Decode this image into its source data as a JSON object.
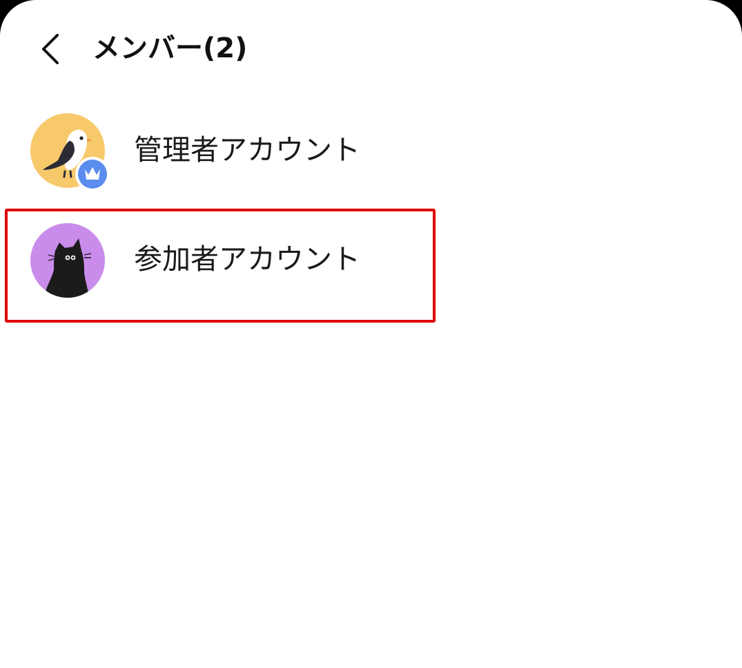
{
  "header": {
    "back_icon": "chevron-left-icon",
    "title": "メンバー(2)"
  },
  "members": [
    {
      "name": "管理者アカウント",
      "avatar": "bird-avatar",
      "avatar_bg": "#F7C96B",
      "role_badge": "crown-icon",
      "badge_color": "#5B8DEF"
    },
    {
      "name": "参加者アカウント",
      "avatar": "cat-avatar",
      "avatar_bg": "#C98CEB"
    }
  ],
  "highlight": {
    "target": "参加者アカウント",
    "color": "#E00000"
  }
}
